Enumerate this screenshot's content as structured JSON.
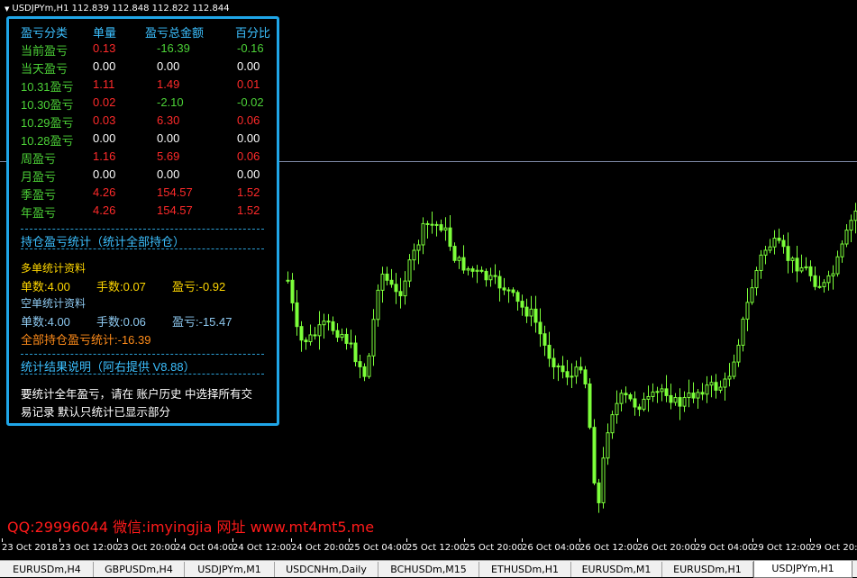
{
  "chart": {
    "title": "USDJPYm,H1  112.839 112.848 112.822 112.844",
    "candle_color": "#7cff3a",
    "background": "#000000"
  },
  "panel": {
    "headers": [
      "盈亏分类",
      "单量",
      "盈亏总金额",
      "百分比"
    ],
    "rows": [
      {
        "label": "当前盈亏",
        "count": "0.13",
        "amount": "-16.39",
        "pct": "-0.16"
      },
      {
        "label": "当天盈亏",
        "count": "0.00",
        "amount": "0.00",
        "pct": "0.00"
      },
      {
        "label": "10.31盈亏",
        "count": "1.11",
        "amount": "1.49",
        "pct": "0.01"
      },
      {
        "label": "10.30盈亏",
        "count": "0.02",
        "amount": "-2.10",
        "pct": "-0.02"
      },
      {
        "label": "10.29盈亏",
        "count": "0.03",
        "amount": "6.30",
        "pct": "0.06"
      },
      {
        "label": "10.28盈亏",
        "count": "0.00",
        "amount": "0.00",
        "pct": "0.00"
      },
      {
        "label": "周盈亏",
        "count": "1.16",
        "amount": "5.69",
        "pct": "0.06"
      },
      {
        "label": "月盈亏",
        "count": "0.00",
        "amount": "0.00",
        "pct": "0.00"
      },
      {
        "label": "季盈亏",
        "count": "4.26",
        "amount": "154.57",
        "pct": "1.52"
      },
      {
        "label": "年盈亏",
        "count": "4.26",
        "amount": "154.57",
        "pct": "1.52"
      }
    ],
    "holding_title": "持仓盈亏统计（统计全部持仓）",
    "long_title": "多单统计资料",
    "long_count": "单数:4.00",
    "long_lots": "手数:0.07",
    "long_pl": "盈亏:-0.92",
    "short_title": "空单统计资料",
    "short_count": "单数:4.00",
    "short_lots": "手数:0.06",
    "short_pl": "盈亏:-15.47",
    "total": "全部持仓盈亏统计:-16.39",
    "notes_title": "统计结果说明（阿右提供 V8.88）",
    "notes_line1": "要统计全年盈亏，请在 账户历史 中选择所有交",
    "notes_line2": "易记录 默认只统计已显示部分",
    "colors": {
      "border": "#1fa6e8",
      "header": "#3cc0ff",
      "label": "#4cd137",
      "red": "#ff2a2a",
      "green": "#4cd137",
      "white": "#ffffff",
      "yellow": "#ffd700",
      "blue_text": "#8ec9f0",
      "orange": "#ff8c1a"
    }
  },
  "promo": "QQ:29996044 微信:imyingjia 网址 www.mt4mt5.me",
  "x_axis_labels": [
    "23 Oct 2018",
    "23 Oct 12:00",
    "23 Oct 20:00",
    "24 Oct 04:00",
    "24 Oct 12:00",
    "24 Oct 20:00",
    "25 Oct 04:00",
    "25 Oct 12:00",
    "25 Oct 20:00",
    "26 Oct 04:00",
    "26 Oct 12:00",
    "26 Oct 20:00",
    "29 Oct 04:00",
    "29 Oct 12:00",
    "29 Oct 20:00"
  ],
  "tabs": [
    "EURUSDm,H4",
    "GBPUSDm,H4",
    "USDJPYm,M1",
    "USDCNHm,Daily",
    "BCHUSDm,M15",
    "ETHUSDm,H1",
    "EURUSDm,M1",
    "EURUSDm,H1",
    "USDJPYm,H1"
  ],
  "active_tab": "USDJPYm,H1"
}
